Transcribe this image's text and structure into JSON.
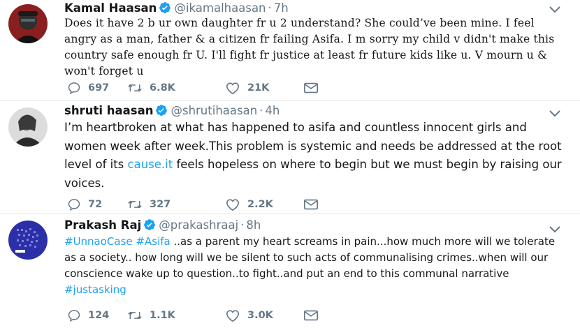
{
  "colors": {
    "text": "#14171a",
    "muted": "#657786",
    "link": "#1da1f2",
    "verified": "#1da1f2",
    "divider": "#e1e8ed"
  },
  "tweets": [
    {
      "avatar_icon": "avatar-kamal",
      "name": "Kamal Haasan",
      "handle": "@ikamalhaasan",
      "time": "7h",
      "text": "Does it have 2 b ur own daughter fr u 2 understand? She could’ve been mine. I feel angry as a man, father & a citizen fr failing Asifa. I m sorry my child v didn't make this country safe enough fr U. I'll fight fr justice at least fr future kids like u. V mourn u & won't forget u",
      "replies": "697",
      "retweets": "6.8K",
      "likes": "21K"
    },
    {
      "avatar_icon": "avatar-shruti",
      "name": "shruti haasan",
      "handle": "@shrutihaasan",
      "time": "4h",
      "text_before_link": "I’m heartbroken at what has happened to asifa and countless innocent girls and women week after week.This problem is systemic and needs be addressed at the root level of its ",
      "link": "cause.it",
      "text_after_link": " feels hopeless on where to begin but we must begin by raising our voices.",
      "replies": "72",
      "retweets": "327",
      "likes": "2.2K"
    },
    {
      "avatar_icon": "avatar-prakash",
      "name": "Prakash Raj",
      "handle": "@prakashraaj",
      "time": "8h",
      "hashtag_1": "#UnnaoCase",
      "hashtag_2": "#Asifa",
      "text_middle": " ..as a parent my heart screams in pain...how much more will we tolerate as a society.. how long will we be silent to such acts of communalising crimes..when will our conscience wake up to question..to fight..and put an end to this  communal narrative ",
      "hashtag_3": "#justasking",
      "replies": "124",
      "retweets": "1.1K",
      "likes": "3.0K"
    }
  ]
}
